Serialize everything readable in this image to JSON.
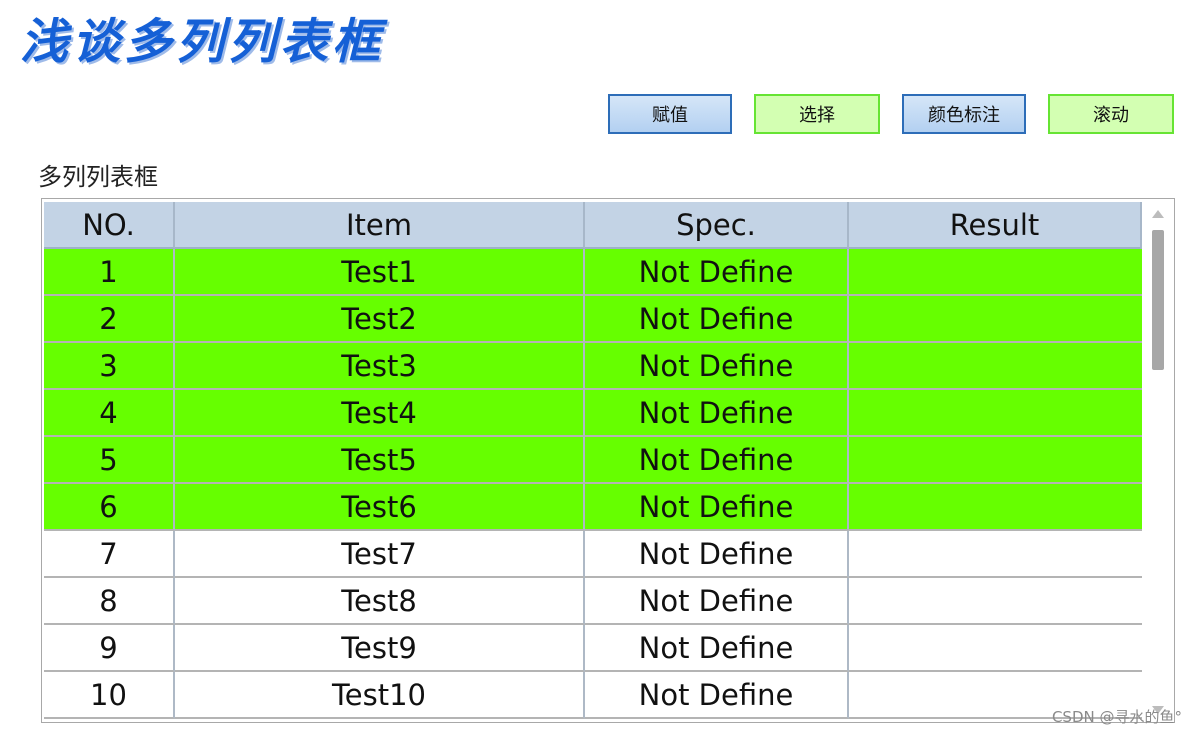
{
  "banner": {
    "title": "浅谈多列列表框"
  },
  "toolbar": {
    "assign_label": "赋值",
    "select_label": "选择",
    "color_label": "颜色标注",
    "scroll_label": "滚动"
  },
  "listbox": {
    "label": "多列列表框",
    "highlight_color": "#66ff00",
    "columns": [
      "NO.",
      "Item",
      "Spec.",
      "Result"
    ],
    "rows": [
      {
        "no": "1",
        "item": "Test1",
        "spec": "Not Define",
        "result": "",
        "highlighted": true
      },
      {
        "no": "2",
        "item": "Test2",
        "spec": "Not Define",
        "result": "",
        "highlighted": true
      },
      {
        "no": "3",
        "item": "Test3",
        "spec": "Not Define",
        "result": "",
        "highlighted": true
      },
      {
        "no": "4",
        "item": "Test4",
        "spec": "Not Define",
        "result": "",
        "highlighted": true
      },
      {
        "no": "5",
        "item": "Test5",
        "spec": "Not Define",
        "result": "",
        "highlighted": true
      },
      {
        "no": "6",
        "item": "Test6",
        "spec": "Not Define",
        "result": "",
        "highlighted": true
      },
      {
        "no": "7",
        "item": "Test7",
        "spec": "Not Define",
        "result": "",
        "highlighted": false
      },
      {
        "no": "8",
        "item": "Test8",
        "spec": "Not Define",
        "result": "",
        "highlighted": false
      },
      {
        "no": "9",
        "item": "Test9",
        "spec": "Not Define",
        "result": "",
        "highlighted": false
      },
      {
        "no": "10",
        "item": "Test10",
        "spec": "Not Define",
        "result": "",
        "highlighted": false
      }
    ]
  },
  "watermark": {
    "text": "CSDN @寻水的鱼°"
  }
}
